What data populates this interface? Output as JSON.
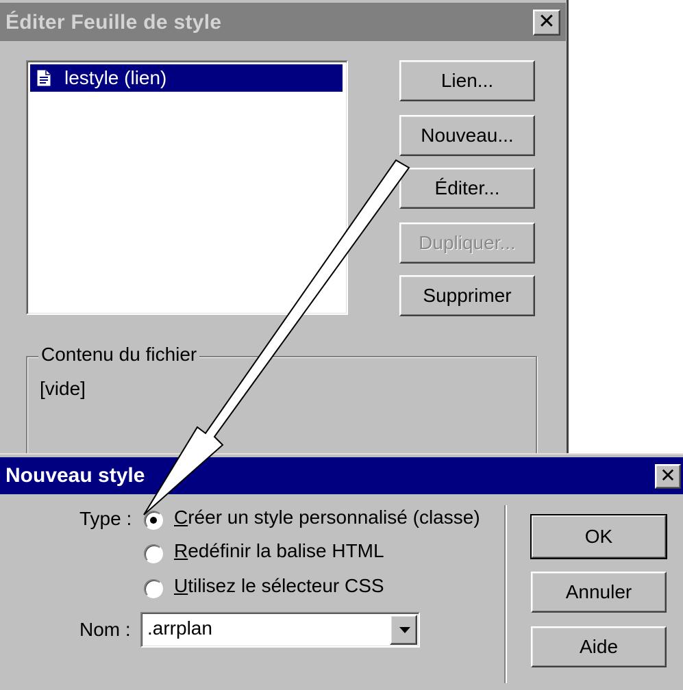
{
  "edit_dialog": {
    "title": "Éditer Feuille de style",
    "close_glyph": "✕",
    "stylesheets": [
      {
        "label": "lestyle (lien)",
        "selected": true
      }
    ],
    "buttons": {
      "link": "Lien...",
      "new": "Nouveau...",
      "edit": "Éditer...",
      "duplicate": "Dupliquer...",
      "delete": "Supprimer"
    },
    "file_content": {
      "legend": "Contenu du fichier",
      "value": "[vide]"
    }
  },
  "new_style_dialog": {
    "title": "Nouveau style",
    "close_glyph": "✕",
    "type_label": "Type :",
    "options": [
      {
        "accel": "C",
        "rest": "réer un style personnalisé (classe)",
        "checked": true
      },
      {
        "accel": "R",
        "rest": "edéfinir la balise HTML",
        "checked": false
      },
      {
        "accel": "U",
        "rest": "tilisez le sélecteur CSS",
        "checked": false
      }
    ],
    "name_label": "Nom :",
    "name_value": ".arrplan",
    "buttons": {
      "ok": "OK",
      "cancel": "Annuler",
      "help": "Aide"
    }
  },
  "colors": {
    "face": "#c0c0c0",
    "inactive_title": "#808080",
    "active_title": "#000080",
    "selection": "#000080"
  }
}
